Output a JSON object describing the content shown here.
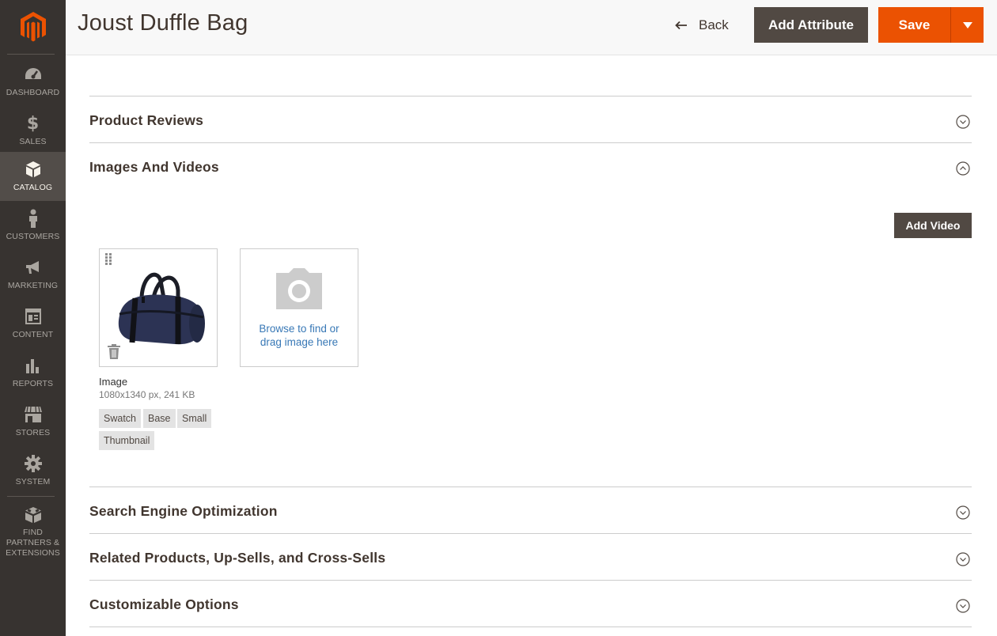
{
  "header": {
    "title": "Joust Duffle Bag",
    "back_label": "Back",
    "add_attribute_label": "Add Attribute",
    "save_label": "Save"
  },
  "sidebar": {
    "items": [
      {
        "label": "DASHBOARD",
        "icon": "dashboard-icon"
      },
      {
        "label": "SALES",
        "icon": "dollar-icon"
      },
      {
        "label": "CATALOG",
        "icon": "box-icon",
        "active": true
      },
      {
        "label": "CUSTOMERS",
        "icon": "person-icon"
      },
      {
        "label": "MARKETING",
        "icon": "megaphone-icon"
      },
      {
        "label": "CONTENT",
        "icon": "content-icon"
      },
      {
        "label": "REPORTS",
        "icon": "bar-chart-icon"
      },
      {
        "label": "STORES",
        "icon": "storefront-icon"
      },
      {
        "label": "SYSTEM",
        "icon": "gear-icon"
      },
      {
        "label": "FIND PARTNERS & EXTENSIONS",
        "icon": "extensions-icon"
      }
    ]
  },
  "sections": {
    "product_reviews": "Product Reviews",
    "images_videos": "Images And Videos",
    "seo": "Search Engine Optimization",
    "related": "Related Products, Up-Sells, and Cross-Sells",
    "custom_options": "Customizable Options"
  },
  "media": {
    "add_video_label": "Add Video",
    "image": {
      "name": "Image",
      "meta": "1080x1340 px, 241 KB",
      "roles": [
        "Swatch",
        "Base",
        "Small",
        "Thumbnail"
      ]
    },
    "upload_text_line1": "Browse to find or",
    "upload_text_line2": "drag image here"
  },
  "colors": {
    "sidebar_bg": "#373330",
    "primary_orange": "#eb5202",
    "dark_button": "#514943",
    "link_blue": "#3878b6"
  }
}
